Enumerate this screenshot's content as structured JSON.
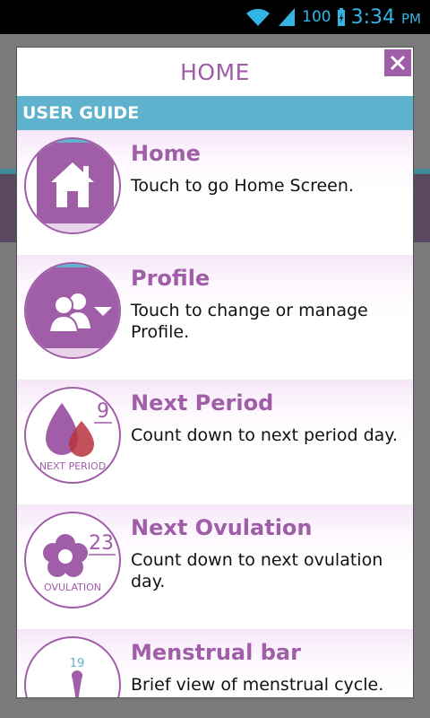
{
  "status_bar": {
    "battery_percent": "100",
    "time": "3:34",
    "ampm": "PM",
    "accent_color": "#35b5e5"
  },
  "dialog": {
    "title": "HOME",
    "close_icon": "close-icon",
    "section_header": "USER GUIDE",
    "items": [
      {
        "icon": "home-icon",
        "title": "Home",
        "description": "Touch to go Home Screen."
      },
      {
        "icon": "profile-icon",
        "title": "Profile",
        "description": "Touch to change or manage Profile."
      },
      {
        "icon": "drop-icon",
        "title": "Next Period",
        "description": "Count down to next period day.",
        "badge_number": "9",
        "badge_label": "NEXT PERIOD"
      },
      {
        "icon": "flower-icon",
        "title": "Next Ovulation",
        "description": "Count down to next ovulation day.",
        "badge_number": "23",
        "badge_label": "OVULATION"
      },
      {
        "icon": "bar-pin-icon",
        "title": "Menstrual bar",
        "description": "Brief view of menstrual cycle.",
        "badge_number": "19"
      }
    ]
  },
  "colors": {
    "brand_purple": "#a05ea8",
    "header_blue": "#5eb2cd"
  }
}
